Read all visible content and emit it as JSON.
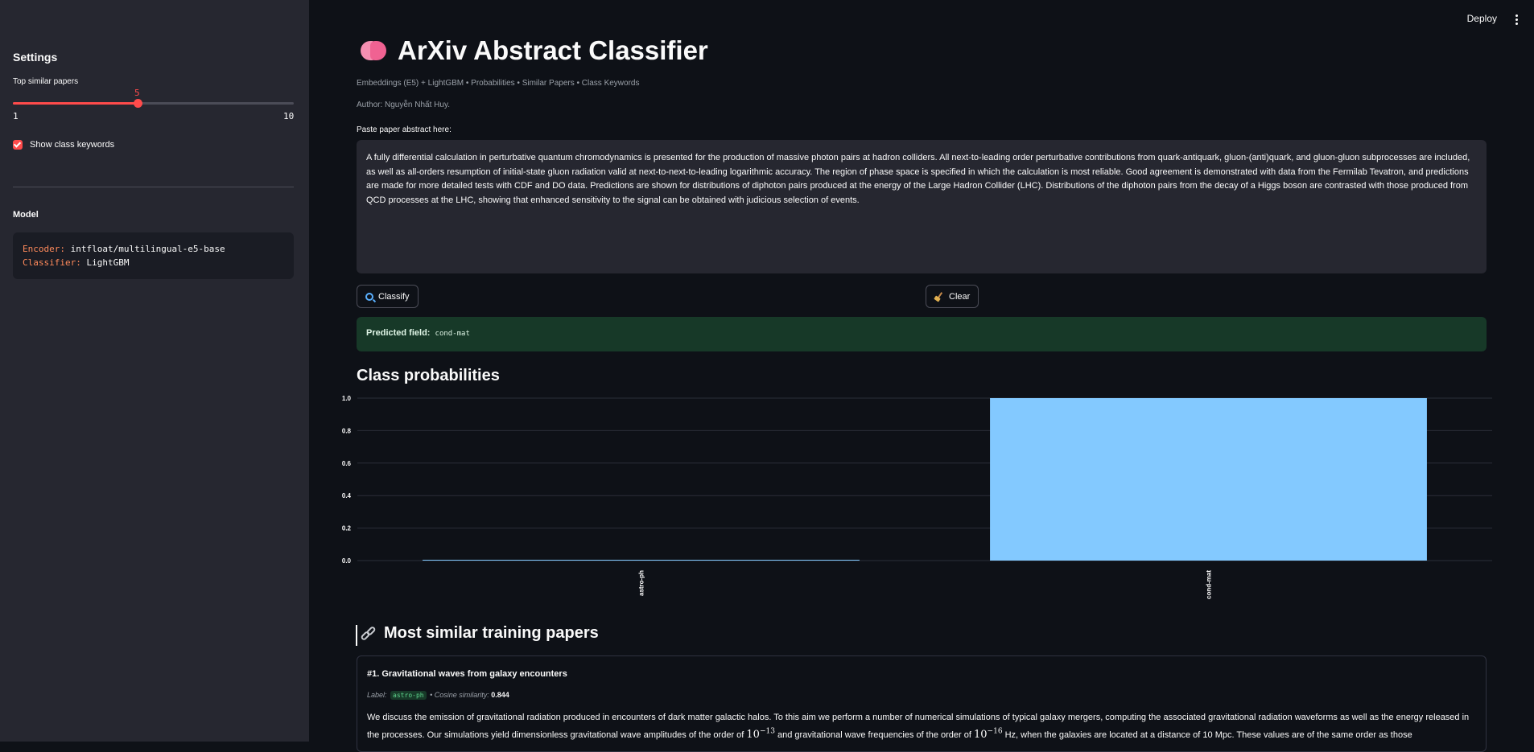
{
  "header": {
    "deploy_label": "Deploy"
  },
  "sidebar": {
    "settings_title": "Settings",
    "slider": {
      "label": "Top similar papers",
      "value": 5,
      "value_text": "5",
      "min": "1",
      "max": "10",
      "fraction": 0.4444
    },
    "checkbox": {
      "label": "Show class keywords",
      "checked": true
    },
    "model_title": "Model",
    "code": {
      "encoder_key": "Encoder:",
      "encoder_value": "intfloat/multilingual-e5-base",
      "classifier_key": "Classifier:",
      "classifier_value": "LightGBM"
    }
  },
  "main": {
    "title": "ArXiv Abstract Classifier",
    "caption": "Embeddings (E5) + LightGBM • Probabilities • Similar Papers • Class Keywords",
    "author": "Author: Nguyễn Nhất Huy.",
    "textarea_label": "Paste paper abstract here:",
    "abstract": "A fully differential calculation in perturbative quantum chromodynamics is presented for the production of massive photon pairs at hadron colliders. All next-to-leading order perturbative contributions from quark-antiquark, gluon-(anti)quark, and gluon-gluon subprocesses are included, as well as all-orders resumption of initial-state gluon radiation valid at next-to-next-to-leading logarithmic accuracy. The region of phase space is specified in which the calculation is most reliable. Good agreement is demonstrated with data from the Fermilab Tevatron, and predictions are made for more detailed tests with CDF and DO data. Predictions are shown for distributions of diphoton pairs produced at the energy of the Large Hadron Collider (LHC). Distributions of the diphoton pairs from the decay of a Higgs boson are contrasted with those produced from QCD processes at the LHC, showing that enhanced sensitivity to the signal can be obtained with judicious selection of events.",
    "classify_label": "Classify",
    "clear_label": "Clear",
    "predicted_label": "Predicted field:",
    "predicted_value": "cond-mat",
    "probabilities_title": "Class probabilities",
    "similar_title": "Most similar training papers",
    "similar": [
      {
        "title": "#1. Gravitational waves from galaxy encounters",
        "label_prefix": "Label:",
        "label": "astro-ph",
        "similarity_prefix": "• Cosine similarity:",
        "similarity": "0.844",
        "body": "We discuss the emission of gravitational radiation produced in encounters of dark matter galactic halos. To this aim we perform a number of numerical simulations of typical galaxy mergers, computing the associated gravitational radiation waveforms as well as the energy released in the processes. Our simulations yield dimensionless gravitational wave amplitudes of the order of 10^−13 and gravitational wave frequencies of the order of 10^−16 Hz, when the galaxies are located at a distance of 10 Mpc. These values are of the same order as those"
      }
    ]
  },
  "chart_data": {
    "type": "bar",
    "categories": [
      "astro-ph",
      "cond-mat"
    ],
    "values": [
      0.0,
      1.0
    ],
    "ylim": [
      0,
      1.0
    ],
    "yticks": [
      "0.0",
      "0.2",
      "0.4",
      "0.6",
      "0.8",
      "1.0"
    ],
    "bar_color": "#83c9ff",
    "grid": true
  }
}
